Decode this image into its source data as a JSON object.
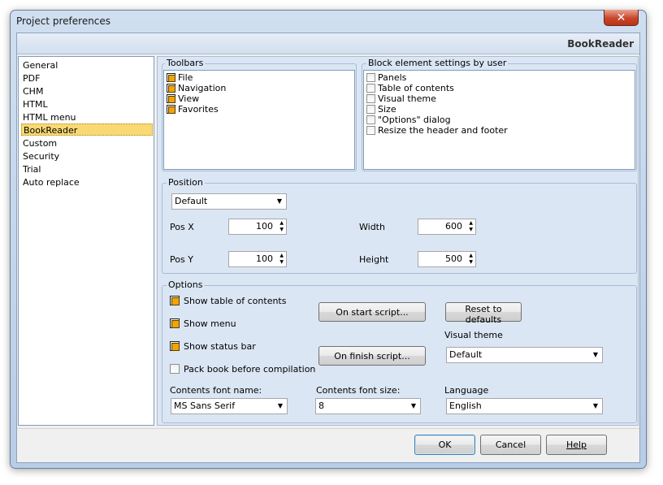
{
  "window": {
    "title": "Project preferences",
    "close_glyph": "✕"
  },
  "header": {
    "title": "BookReader"
  },
  "nav": {
    "items": [
      "General",
      "PDF",
      "CHM",
      "HTML",
      "HTML menu",
      "BookReader",
      "Custom",
      "Security",
      "Trial",
      "Auto replace"
    ],
    "selected": "BookReader"
  },
  "toolbars": {
    "title": "Toolbars",
    "items": [
      {
        "label": "File",
        "checked": true
      },
      {
        "label": "Navigation",
        "checked": true
      },
      {
        "label": "View",
        "checked": true
      },
      {
        "label": "Favorites",
        "checked": true
      }
    ]
  },
  "block_settings": {
    "title": "Block element settings by user",
    "items": [
      {
        "label": "Panels",
        "checked": false
      },
      {
        "label": "Table of contents",
        "checked": false
      },
      {
        "label": "Visual theme",
        "checked": false
      },
      {
        "label": "Size",
        "checked": false
      },
      {
        "label": "\"Options\" dialog",
        "checked": false
      },
      {
        "label": "Resize the header and footer",
        "checked": false
      }
    ]
  },
  "position": {
    "title": "Position",
    "mode": "Default",
    "pos_x_label": "Pos X",
    "pos_x": "100",
    "pos_y_label": "Pos Y",
    "pos_y": "100",
    "width_label": "Width",
    "width": "600",
    "height_label": "Height",
    "height": "500"
  },
  "options": {
    "title": "Options",
    "show_toc": "Show table of contents",
    "show_menu": "Show menu",
    "show_status_bar": "Show status bar",
    "pack_book": "Pack book before compilation",
    "on_start_script": "On start script...",
    "on_finish_script": "On finish script...",
    "reset_defaults": "Reset to defaults",
    "visual_theme_label": "Visual theme",
    "visual_theme": "Default",
    "contents_font_name_label": "Contents font name:",
    "contents_font_name": "MS Sans Serif",
    "contents_font_size_label": "Contents font size:",
    "contents_font_size": "8",
    "language_label": "Language",
    "language": "English",
    "show_toc_checked": true,
    "show_menu_checked": true,
    "show_status_bar_checked": true,
    "pack_book_checked": false
  },
  "footer": {
    "ok": "OK",
    "cancel": "Cancel",
    "help": "Help"
  },
  "icons": {
    "dropdown_arrow": "▼",
    "spin_up": "▲",
    "spin_down": "▼"
  }
}
